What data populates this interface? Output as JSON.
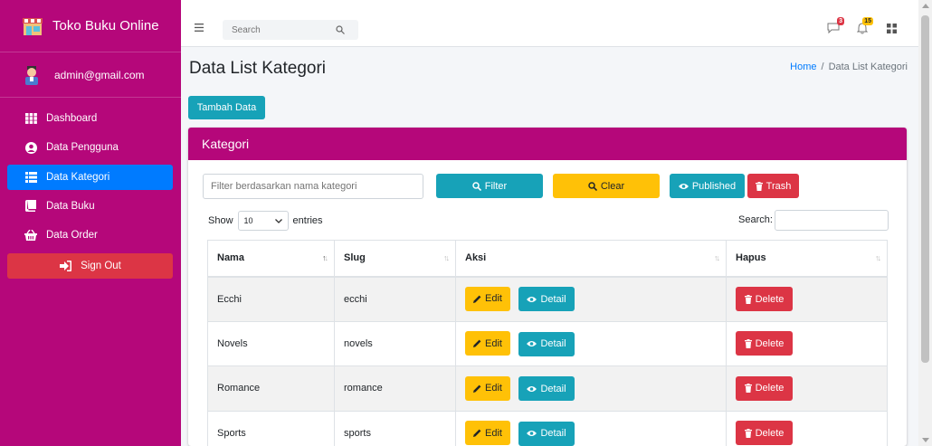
{
  "app": {
    "title": "Toko Buku Online"
  },
  "user": {
    "email": "admin@gmail.com"
  },
  "sidebar": {
    "items": [
      {
        "label": "Dashboard",
        "icon": "grid-icon"
      },
      {
        "label": "Data Pengguna",
        "icon": "user-circle-icon"
      },
      {
        "label": "Data Kategori",
        "icon": "list-icon"
      },
      {
        "label": "Data Buku",
        "icon": "book-icon"
      },
      {
        "label": "Data Order",
        "icon": "basket-icon"
      }
    ],
    "active": "Data Kategori",
    "signout_label": "Sign Out"
  },
  "topbar": {
    "search_placeholder": "Search",
    "message_count": "3",
    "notification_count": "15"
  },
  "page": {
    "title": "Data List Kategori",
    "breadcrumb_home": "Home",
    "breadcrumb_sep": "/",
    "breadcrumb_current": "Data List Kategori",
    "add_button": "Tambah Data"
  },
  "card": {
    "title": "Kategori",
    "filter_placeholder": "Filter berdasarkan nama kategori",
    "filter_button": "Filter",
    "clear_button": "Clear",
    "published_button": "Published",
    "trash_button": "Trash",
    "show_label": "Show",
    "entries_value": "10",
    "entries_label": "entries",
    "search_label": "Search:"
  },
  "table": {
    "headers": {
      "nama": "Nama",
      "slug": "Slug",
      "aksi": "Aksi",
      "hapus": "Hapus"
    },
    "edit_label": "Edit",
    "detail_label": "Detail",
    "delete_label": "Delete",
    "rows": [
      {
        "nama": "Ecchi",
        "slug": "ecchi"
      },
      {
        "nama": "Novels",
        "slug": "novels"
      },
      {
        "nama": "Romance",
        "slug": "romance"
      },
      {
        "nama": "Sports",
        "slug": "sports"
      }
    ]
  },
  "colors": {
    "primary": "#b5077a",
    "active_nav": "#007bff",
    "info": "#17a2b8",
    "warning": "#ffc107",
    "danger": "#dc3545"
  }
}
